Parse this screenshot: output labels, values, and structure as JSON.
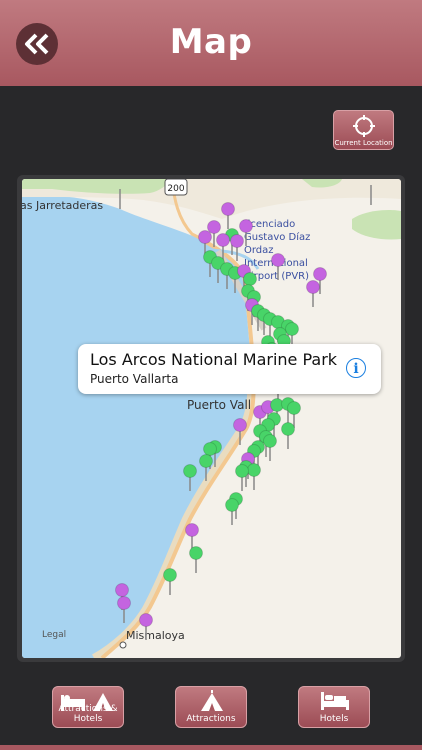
{
  "header": {
    "title": "Map",
    "back_icon": "double-chevron-left-icon"
  },
  "current_location": {
    "label": "Current Location",
    "icon": "crosshair-icon"
  },
  "map": {
    "labels": {
      "las_jarretaderas": "as Jarretaderas",
      "highway": "200",
      "airport_l1": "Licenciado",
      "airport_l2": "Gustavo Díaz",
      "airport_l3": "Ordaz",
      "airport_l4": "International",
      "airport_l5": "Airport (PVR)",
      "puerto_vallarta": "Puerto Vall",
      "mismaloya": "Mismaloya",
      "legal": "Legal"
    },
    "pin_colors": {
      "attraction": "#c464e0",
      "hotel": "#48d468"
    }
  },
  "callout": {
    "title": "Los Arcos National Marine Park",
    "subtitle": "Puerto Vallarta",
    "info_icon": "info-icon"
  },
  "tabs": [
    {
      "label": "Attractions & Hotels",
      "icon": "bed-tent-icon"
    },
    {
      "label": "Attractions",
      "icon": "tent-icon"
    },
    {
      "label": "Hotels",
      "icon": "bed-icon"
    }
  ]
}
